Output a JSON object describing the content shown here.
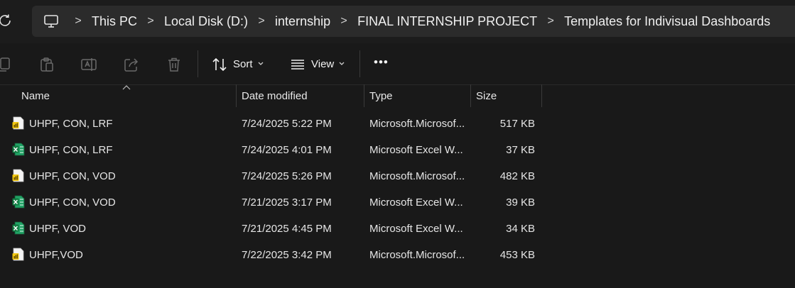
{
  "breadcrumb": {
    "items": [
      "This PC",
      "Local Disk (D:)",
      "internship",
      "FINAL INTERNSHIP PROJECT",
      "Templates for Indivisual Dashboards"
    ],
    "separator": ">"
  },
  "toolbar": {
    "sort_label": "Sort",
    "view_label": "View",
    "more_label": "•••"
  },
  "columns": {
    "name": "Name",
    "date_modified": "Date modified",
    "type": "Type",
    "size": "Size"
  },
  "files": [
    {
      "name": "UHPF, CON, LRF",
      "date": "7/24/2025 5:22 PM",
      "type": "Microsoft.Microsof...",
      "size": "517 KB",
      "icon": "pbix-file-icon"
    },
    {
      "name": "UHPF, CON, LRF",
      "date": "7/24/2025 4:01 PM",
      "type": "Microsoft Excel W...",
      "size": "37 KB",
      "icon": "excel-file-icon"
    },
    {
      "name": "UHPF, CON, VOD",
      "date": "7/24/2025 5:26 PM",
      "type": "Microsoft.Microsof...",
      "size": "482 KB",
      "icon": "pbix-file-icon"
    },
    {
      "name": "UHPF, CON, VOD",
      "date": "7/21/2025 3:17 PM",
      "type": "Microsoft Excel W...",
      "size": "39 KB",
      "icon": "excel-file-icon"
    },
    {
      "name": "UHPF, VOD",
      "date": "7/21/2025 4:45 PM",
      "type": "Microsoft Excel W...",
      "size": "34 KB",
      "icon": "excel-file-icon"
    },
    {
      "name": "UHPF,VOD",
      "date": "7/22/2025 3:42 PM",
      "type": "Microsoft.Microsof...",
      "size": "453 KB",
      "icon": "pbix-file-icon"
    }
  ],
  "colors": {
    "background": "#191919",
    "address_bar": "#2b2b2b",
    "excel_green": "#1d6f42",
    "pbix_yellow": "#f2c811"
  }
}
